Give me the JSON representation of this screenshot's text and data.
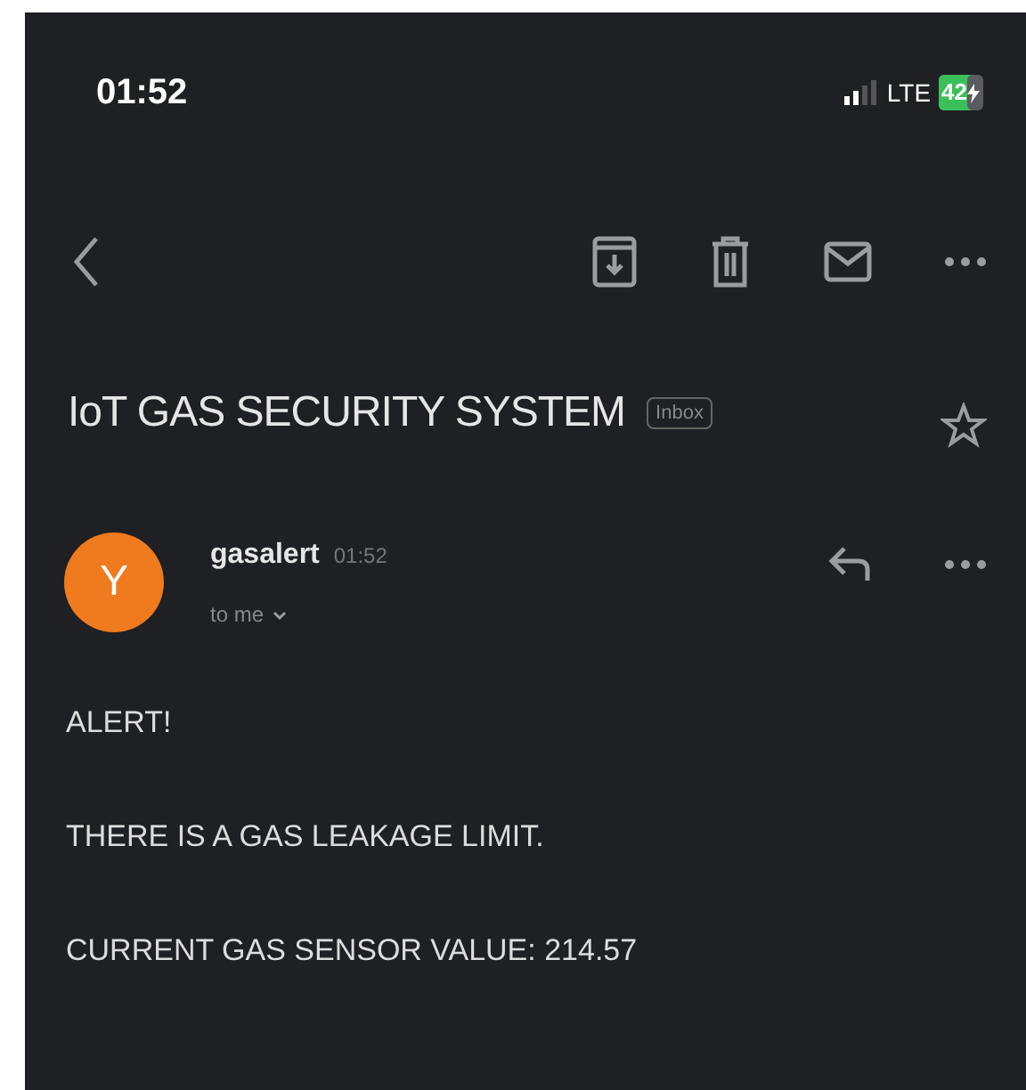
{
  "status_bar": {
    "time": "01:52",
    "network": "LTE",
    "battery": "42"
  },
  "email": {
    "subject": "IoT GAS SECURITY SYSTEM",
    "label": "Inbox",
    "starred": false,
    "sender": {
      "name": "gasalert",
      "initial": "Y",
      "time": "01:52",
      "recipient": "to me"
    },
    "body": [
      "ALERT!",
      "THERE IS A GAS LEAKAGE LIMIT.",
      "CURRENT GAS SENSOR VALUE: 214.57"
    ]
  }
}
